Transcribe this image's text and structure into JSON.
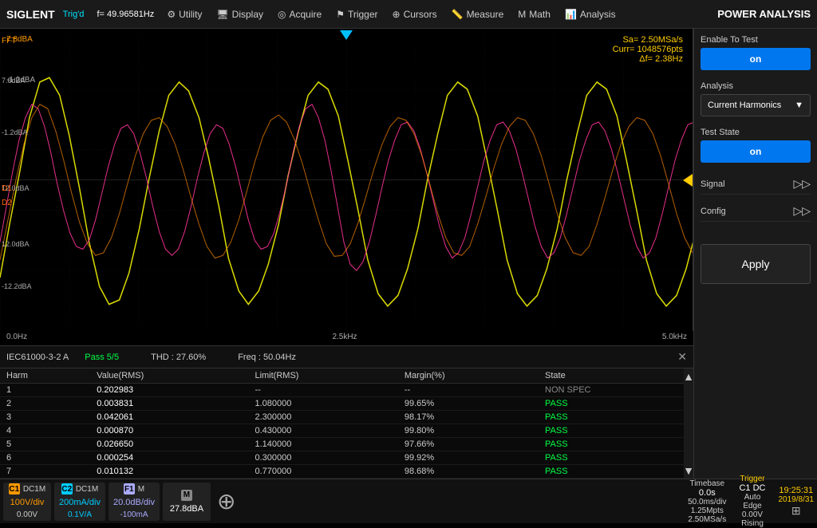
{
  "brand": "SIGLENT",
  "trigger_status": "Trig'd",
  "frequency": "f= 49.96581Hz",
  "menu": {
    "items": [
      {
        "label": "Utility",
        "icon": "⚙"
      },
      {
        "label": "Display",
        "icon": "🖥"
      },
      {
        "label": "Acquire",
        "icon": "📡"
      },
      {
        "label": "Trigger",
        "icon": "⚑"
      },
      {
        "label": "Cursors",
        "icon": "⊕"
      },
      {
        "label": "Measure",
        "icon": "📏"
      },
      {
        "label": "Math",
        "icon": "M"
      },
      {
        "label": "Analysis",
        "icon": "📊"
      }
    ]
  },
  "right_panel_title": "POWER ANALYSIS",
  "enable_to_test_label": "Enable To Test",
  "enable_to_test_value": "on",
  "analysis_label": "Analysis",
  "analysis_value": "Current Harmonics",
  "test_state_label": "Test State",
  "test_state_value": "on",
  "signal_label": "Signal",
  "config_label": "Config",
  "apply_label": "Apply",
  "waveform": {
    "sa": "Sa= 2.50MSa/s",
    "curr": "Curr= 1048576pts",
    "delta": "Δf= 2.38Hz",
    "y_labels": [
      "7.8dBA",
      "-1.2dBA",
      "12.0dBA",
      "12.0dBA",
      "-12.2dBA"
    ],
    "x_labels": [
      "0.0Hz",
      "2.5kHz",
      "5.0kHz"
    ],
    "fft_label": "FFT"
  },
  "table": {
    "standard": "IEC61000-3-2 A",
    "result": "Pass 5/5",
    "thd_label": "THD : 27.60%",
    "freq_label": "Freq : 50.04Hz",
    "columns": [
      "Harm",
      "Value(RMS)",
      "Limit(RMS)",
      "Margin(%)",
      "State"
    ],
    "rows": [
      {
        "harm": "1",
        "value": "0.202983",
        "limit": "--",
        "margin": "--",
        "state": "NON SPEC",
        "state_type": "nonspec"
      },
      {
        "harm": "2",
        "value": "0.003831",
        "limit": "1.080000",
        "margin": "99.65%",
        "state": "PASS",
        "state_type": "pass"
      },
      {
        "harm": "3",
        "value": "0.042061",
        "limit": "2.300000",
        "margin": "98.17%",
        "state": "PASS",
        "state_type": "pass"
      },
      {
        "harm": "4",
        "value": "0.000870",
        "limit": "0.430000",
        "margin": "99.80%",
        "state": "PASS",
        "state_type": "pass"
      },
      {
        "harm": "5",
        "value": "0.026650",
        "limit": "1.140000",
        "margin": "97.66%",
        "state": "PASS",
        "state_type": "pass"
      },
      {
        "harm": "6",
        "value": "0.000254",
        "limit": "0.300000",
        "margin": "99.92%",
        "state": "PASS",
        "state_type": "pass"
      },
      {
        "harm": "7",
        "value": "0.010132",
        "limit": "0.770000",
        "margin": "98.68%",
        "state": "PASS",
        "state_type": "pass"
      }
    ]
  },
  "bottom_bar": {
    "channels": [
      {
        "id": "C1",
        "type": "c1",
        "mode": "DC1M",
        "val1": "100V/div",
        "val2": "0.00V"
      },
      {
        "id": "C2",
        "type": "c2",
        "mode": "DC1M",
        "val1": "200mA/div",
        "val2": "0.1V/A"
      },
      {
        "id": "F1",
        "type": "f1",
        "mode": "M",
        "val1": "20.0dB/div",
        "val2": "-100mA"
      },
      {
        "id": "M",
        "type": "m",
        "mode": "",
        "val1": "27.8dBA",
        "val2": ""
      }
    ],
    "timebase_label": "Timebase",
    "timebase_val1": "0.0s",
    "timebase_val2": "50.0ms/div",
    "timebase_val3": "1.25Mpts",
    "timebase_val4": "2.50MSa/s",
    "trigger_label": "Trigger",
    "trigger_source": "C1 DC",
    "trigger_mode": "Auto",
    "trigger_type": "Edge",
    "trigger_level": "0.00V",
    "trigger_slope": "Rising",
    "datetime": "19:25:31",
    "date": "2019/8/31"
  }
}
